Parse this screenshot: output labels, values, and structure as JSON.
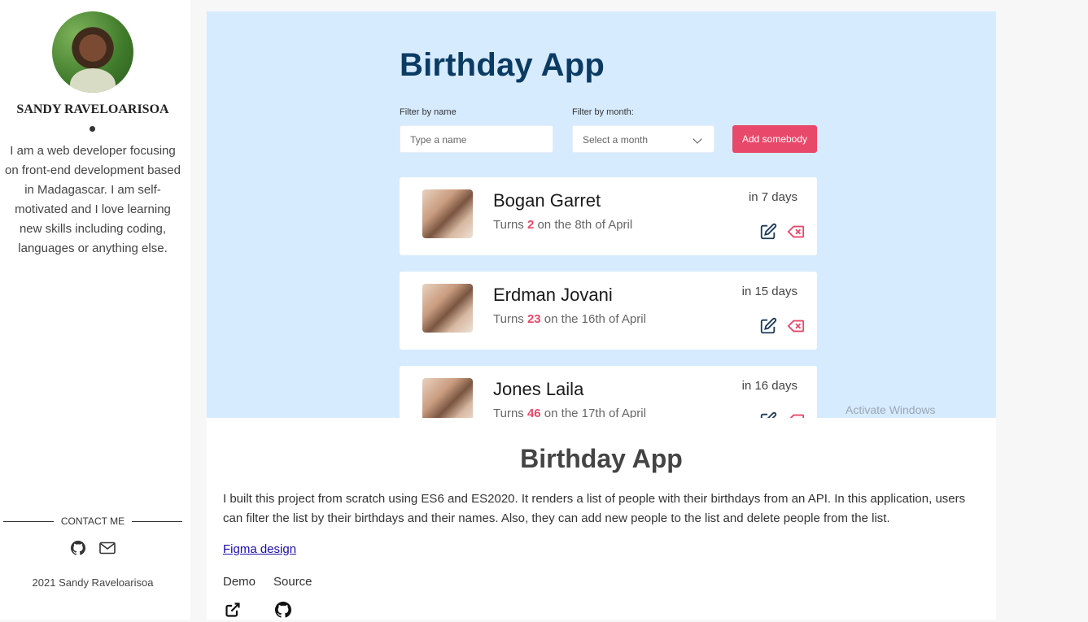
{
  "sidebar": {
    "name": "SANDY RAVELOARISOA",
    "bio": "I am a web developer focusing on front-end development based in Madagascar. I am self-motivated and I love learning new skills including coding, languages or anything else.",
    "contact_label": "CONTACT ME",
    "contact_icons": [
      "github-icon",
      "mail-icon"
    ],
    "footer": "2021 Sandy Raveloarisoa"
  },
  "preview": {
    "app_title": "Birthday App",
    "filter_name_label": "Filter by name",
    "filter_name_placeholder": "Type a name",
    "filter_month_label": "Filter by month:",
    "filter_month_placeholder": "Select a month",
    "add_button": "Add somebody",
    "people": [
      {
        "name": "Bogan Garret",
        "turns_prefix": "Turns ",
        "age": "2",
        "turns_suffix": " on the 8th of April",
        "days": "in 7 days"
      },
      {
        "name": "Erdman Jovani",
        "turns_prefix": "Turns ",
        "age": "23",
        "turns_suffix": " on the 16th of April",
        "days": "in 15 days"
      },
      {
        "name": "Jones Laila",
        "turns_prefix": "Turns ",
        "age": "46",
        "turns_suffix": " on the 17th of April",
        "days": "in 16 days"
      }
    ],
    "watermark": "Activate Windows",
    "accent_color": "#e8486a",
    "title_color": "#0a3b63",
    "background_color": "#d7ebff"
  },
  "project": {
    "title": "Birthday App",
    "description": "I built this project from scratch using ES6 and ES2020. It renders a list of people with their birthdays from an API. In this application, users can filter the list by their birthdays and their names. Also, they can add new people to the list and delete people from the list.",
    "figma_link": "Figma design",
    "demo_label": "Demo",
    "source_label": "Source",
    "demo_icon": "external-link-icon",
    "source_icon": "github-icon"
  }
}
